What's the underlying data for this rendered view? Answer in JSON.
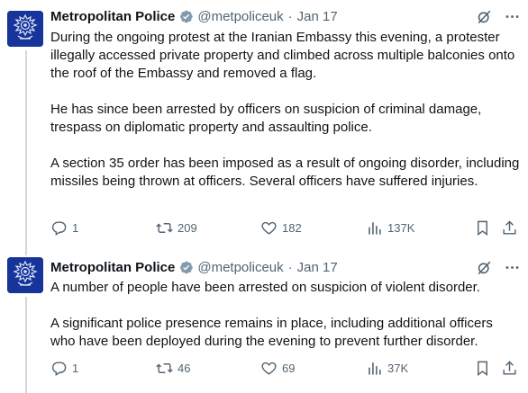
{
  "tweets": [
    {
      "author_name": "Metropolitan Police",
      "handle": "@metpoliceuk",
      "separator": "·",
      "date": "Jan 17",
      "paragraphs": [
        "During the ongoing protest at the Iranian Embassy this evening, a protester illegally accessed private property and climbed across multiple balconies onto the roof of the Embassy and removed a flag.",
        "He has since been arrested by officers on suspicion of criminal damage, trespass on diplomatic property and assaulting police.",
        "A section 35 order has been imposed as a result of ongoing disorder, including missiles being thrown at officers. Several officers have suffered injuries."
      ],
      "stats": {
        "replies": "1",
        "reposts": "209",
        "likes": "182",
        "views": "137K"
      }
    },
    {
      "author_name": "Metropolitan Police",
      "handle": "@metpoliceuk",
      "separator": "·",
      "date": "Jan 17",
      "paragraphs": [
        "A number of people have been arrested on suspicion of violent disorder.",
        "A significant police presence remains in place, including additional officers who have been deployed during the evening to prevent further disorder."
      ],
      "stats": {
        "replies": "1",
        "reposts": "46",
        "likes": "69",
        "views": "37K"
      }
    }
  ],
  "icons": {
    "verified": "verified-badge-icon",
    "grok": "grok-icon",
    "more": "more-options-icon",
    "reply": "reply-icon",
    "repost": "repost-icon",
    "like": "like-icon",
    "views": "views-icon",
    "bookmark": "bookmark-icon",
    "share": "share-icon"
  },
  "colors": {
    "avatar_background": "#16349a",
    "verified_badge": "#829aab",
    "text": "#0f1419",
    "secondary_text": "#536471"
  }
}
